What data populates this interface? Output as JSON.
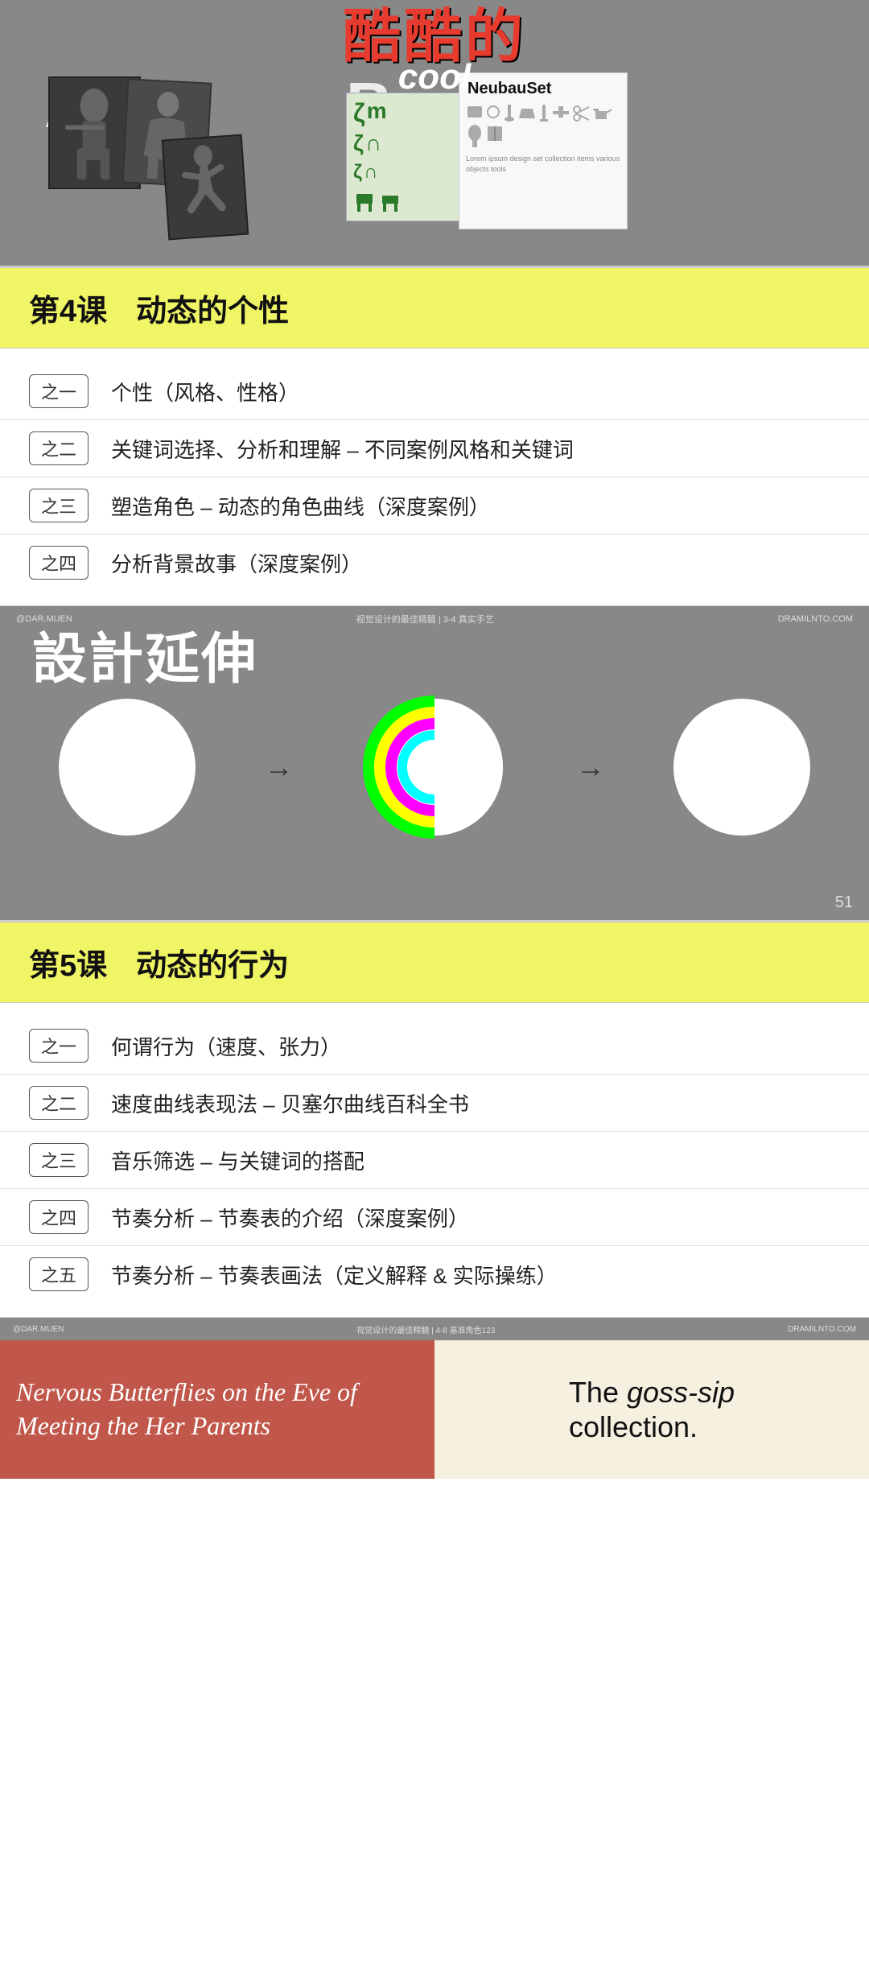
{
  "banner": {
    "title_zh": "酷酷的",
    "title_en": "cool",
    "label_a": "A",
    "label_b": "B",
    "neubau_label": "NeubauSet"
  },
  "lesson4": {
    "number": "第4课",
    "title": "动态的个性",
    "items": [
      {
        "badge": "之一",
        "text": "个性（风格、性格）"
      },
      {
        "badge": "之二",
        "text": "关键词选择、分析和理解 – 不同案例风格和关键词"
      },
      {
        "badge": "之三",
        "text": "塑造角色 – 动态的角色曲线（深度案例）"
      },
      {
        "badge": "之四",
        "text": "分析背景故事（深度案例）"
      }
    ]
  },
  "slide1": {
    "header_left": "@DAR.MUEN",
    "header_center": "视觉设计的最佳精髓 | 3-4 真实手艺",
    "header_right": "DRAMILNTO.COM",
    "main_title": "設計延伸",
    "page_num": "51"
  },
  "lesson5": {
    "number": "第5课",
    "title": "动态的行为",
    "items": [
      {
        "badge": "之一",
        "text": "何谓行为（速度、张力）"
      },
      {
        "badge": "之二",
        "text": "速度曲线表现法 – 贝塞尔曲线百科全书"
      },
      {
        "badge": "之三",
        "text": "音乐筛选 – 与关键词的搭配"
      },
      {
        "badge": "之四",
        "text": "节奏分析 – 节奏表的介绍（深度案例）"
      },
      {
        "badge": "之五",
        "text": "节奏分析 – 节奏表画法（定义解释 & 实际操练）"
      }
    ]
  },
  "slide2": {
    "header_left": "@DAR.MUEN",
    "header_center": "视觉设计的最佳精髓 | 4-8 基准角色123",
    "header_right": "DRAMILNTO.COM",
    "nervous_text": "Nervous Butterflies on the Eve of Meeting the Her Parents",
    "goss_text_1": "The",
    "goss_italic": "goss-sip",
    "goss_text_2": "collection."
  }
}
